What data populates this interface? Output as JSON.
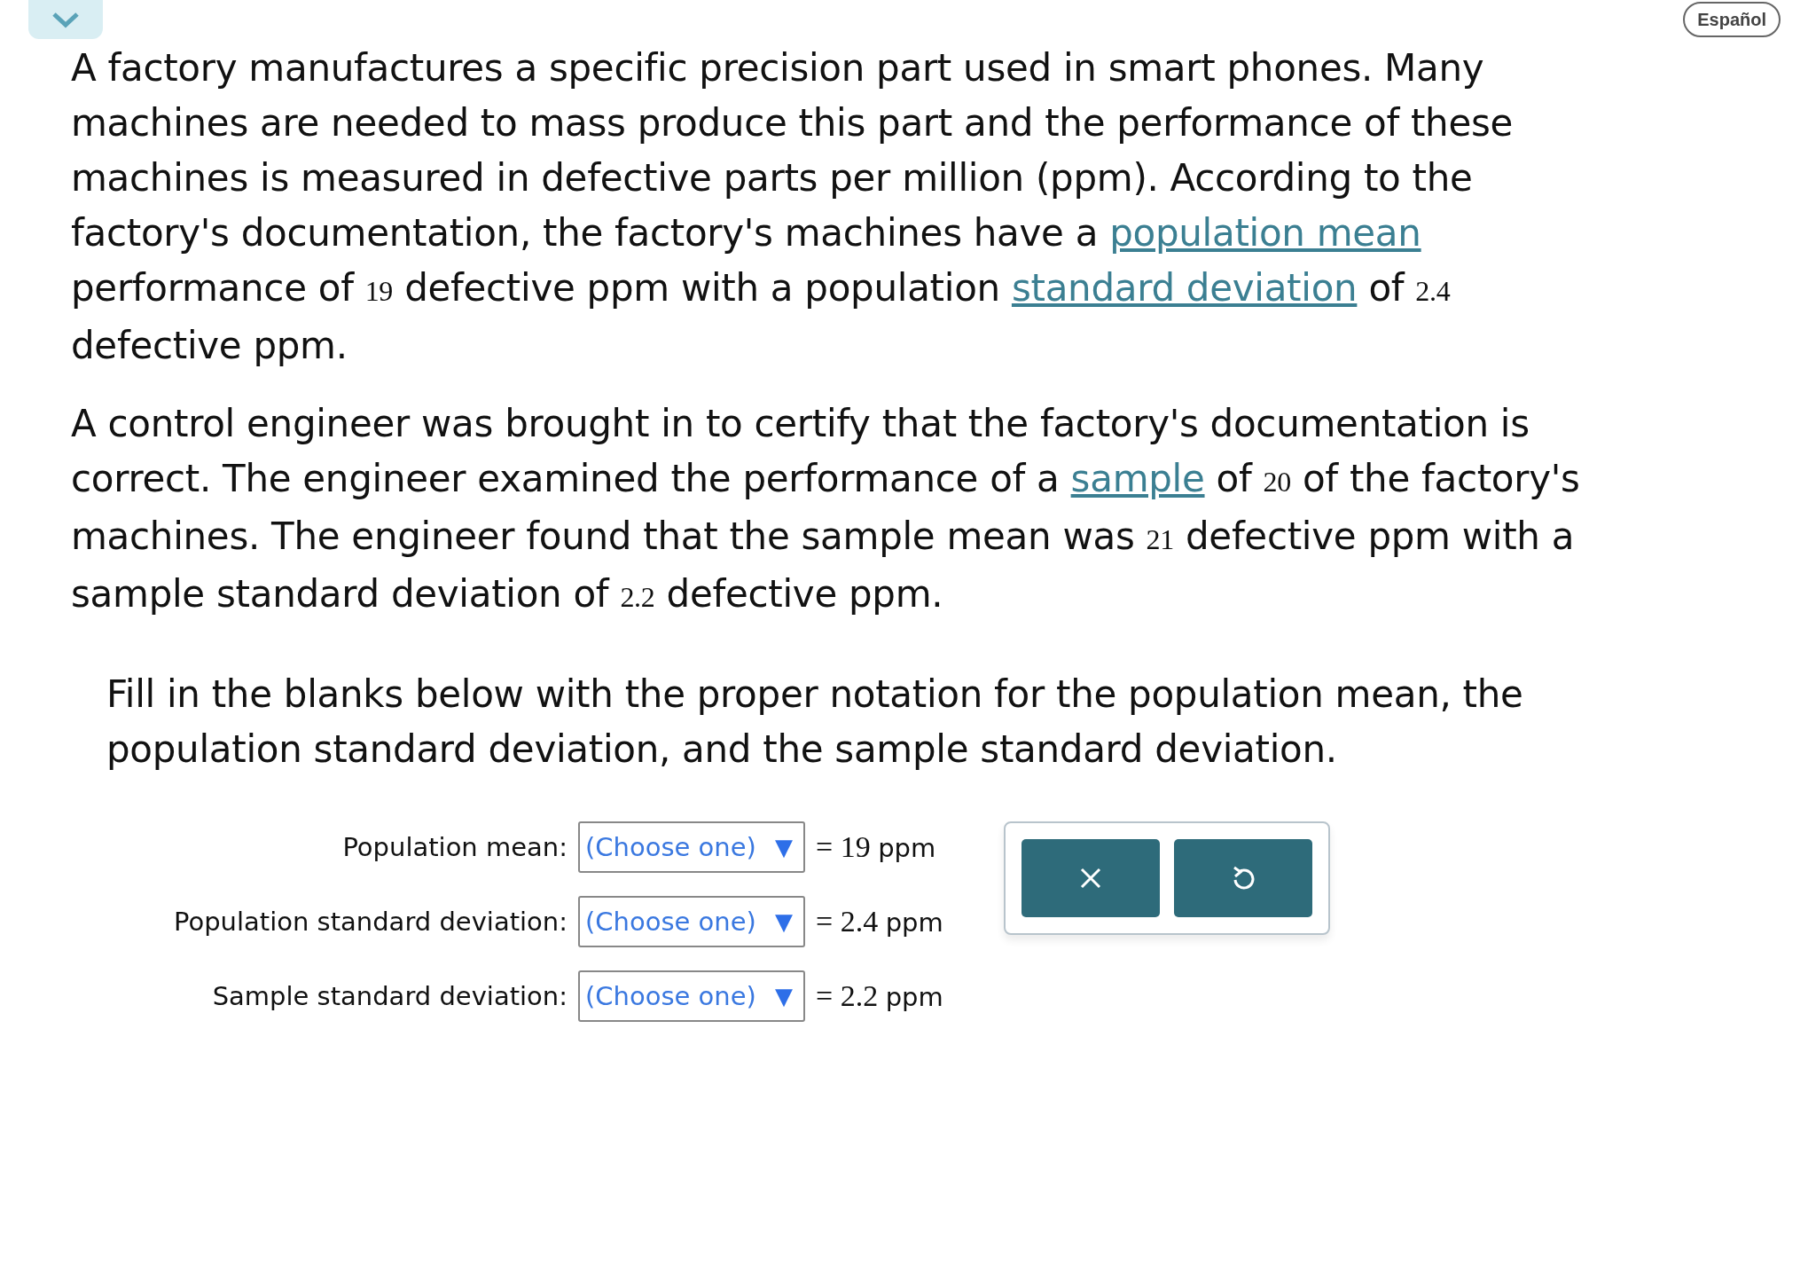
{
  "collapse_button": {
    "expanded": true
  },
  "language_button": {
    "label": "Español"
  },
  "problem_paragraphs": [
    [
      {
        "kind": "text",
        "text": "A factory manufactures a specific precision part used in smart phones. Many machines are needed to mass produce this part and the performance of these machines is measured in defective parts per million (ppm). According to the factory's documentation, the factory's machines have a "
      },
      {
        "kind": "link",
        "text": "population mean"
      },
      {
        "kind": "text",
        "text": " performance of "
      },
      {
        "kind": "number",
        "text": "19"
      },
      {
        "kind": "text",
        "text": " defective ppm with a population "
      },
      {
        "kind": "link",
        "text": "standard deviation"
      },
      {
        "kind": "text",
        "text": " of "
      },
      {
        "kind": "number",
        "text": "2.4"
      },
      {
        "kind": "text",
        "text": " defective ppm."
      }
    ],
    [
      {
        "kind": "text",
        "text": "A control engineer was brought in to certify that the factory's documentation is correct. The engineer examined the performance of a "
      },
      {
        "kind": "link",
        "text": "sample"
      },
      {
        "kind": "text",
        "text": " of "
      },
      {
        "kind": "number",
        "text": "20"
      },
      {
        "kind": "text",
        "text": " of the factory's machines. The engineer found that the sample mean was "
      },
      {
        "kind": "number",
        "text": "21"
      },
      {
        "kind": "text",
        "text": " defective ppm with a sample standard deviation of "
      },
      {
        "kind": "number",
        "text": "2.2"
      },
      {
        "kind": "text",
        "text": " defective ppm."
      }
    ]
  ],
  "instruction": "Fill in the blanks below with the proper notation for the population mean, the population standard deviation, and the sample standard deviation.",
  "answer_rows": [
    {
      "label": "Population mean:",
      "select": "(Choose one)",
      "caret": "▼",
      "value": "19",
      "unit": "ppm"
    },
    {
      "label": "Population standard deviation:",
      "select": "(Choose one)",
      "caret": "▼",
      "value": "2.4",
      "unit": "ppm"
    },
    {
      "label": "Sample standard deviation:",
      "select": "(Choose one)",
      "caret": "▼",
      "value": "2.2",
      "unit": "ppm"
    }
  ],
  "equals_sign": "=",
  "action_buttons": [
    {
      "kind": "clear"
    },
    {
      "kind": "undo"
    }
  ]
}
